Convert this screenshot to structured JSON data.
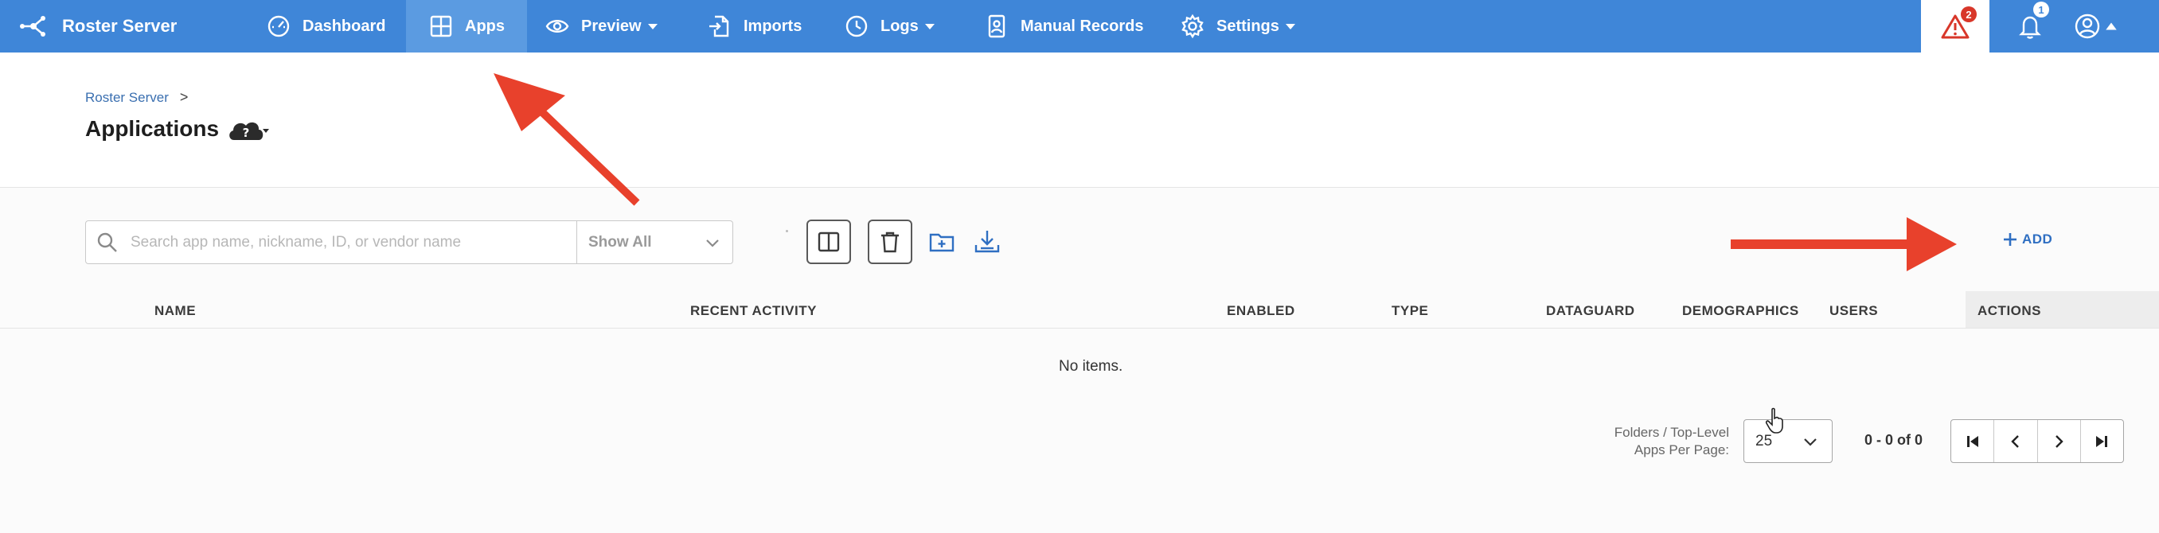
{
  "app": {
    "title": "Roster Server"
  },
  "nav": {
    "items": [
      {
        "label": "Dashboard",
        "icon": "gauge-icon"
      },
      {
        "label": "Apps",
        "icon": "grid-icon",
        "active": true
      },
      {
        "label": "Preview",
        "icon": "eye-icon",
        "has_menu": true
      },
      {
        "label": "Imports",
        "icon": "file-import-icon"
      },
      {
        "label": "Logs",
        "icon": "clock-icon",
        "has_menu": true
      },
      {
        "label": "Manual Records",
        "icon": "person-file-icon"
      },
      {
        "label": "Settings",
        "icon": "gear-icon",
        "has_menu": true
      }
    ],
    "alerts_count": "2",
    "notifications_count": "1"
  },
  "page": {
    "breadcrumb": "Roster Server",
    "breadcrumb_sep": ">",
    "title": "Applications"
  },
  "toolbar": {
    "search_placeholder": "Search app name, nickname, ID, or vendor name",
    "search_value": "",
    "filter_value": "Show All",
    "add_label": "ADD"
  },
  "table": {
    "columns": [
      "NAME",
      "RECENT ACTIVITY",
      "ENABLED",
      "TYPE",
      "DATAGUARD",
      "DEMOGRAPHICS",
      "USERS",
      "ACTIONS"
    ],
    "empty_text": "No items."
  },
  "pagination": {
    "per_page_label_1": "Folders / Top-Level",
    "per_page_label_2": "Apps Per Page:",
    "per_page_value": "25",
    "range_text": "0 - 0 of 0"
  },
  "colors": {
    "navbar": "#3f86d8",
    "nav_active": "#5b9be1",
    "link": "#2f6fc2",
    "alert": "#d8372a",
    "annotation_arrow": "#e8412c"
  }
}
